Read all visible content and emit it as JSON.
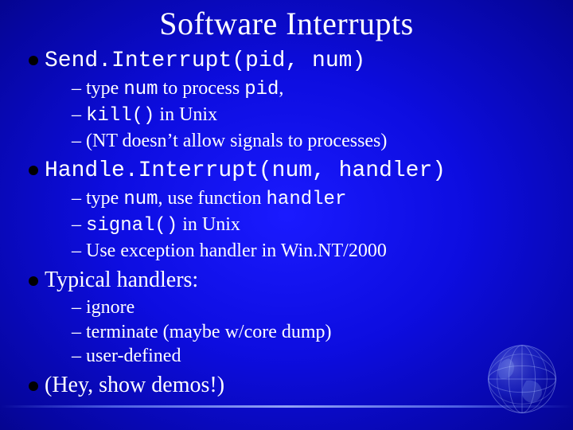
{
  "title": "Software Interrupts",
  "bullets": [
    {
      "main": {
        "segments": [
          {
            "text": "Send.Interrupt(pid, num)",
            "mono": true
          }
        ]
      },
      "subs": [
        {
          "segments": [
            {
              "text": "type "
            },
            {
              "text": "num",
              "mono": true
            },
            {
              "text": " to process "
            },
            {
              "text": "pid",
              "mono": true
            },
            {
              "text": ","
            }
          ]
        },
        {
          "segments": [
            {
              "text": "kill()",
              "mono": true
            },
            {
              "text": " in Unix"
            }
          ]
        },
        {
          "segments": [
            {
              "text": "(NT doesn’t allow signals to processes)"
            }
          ]
        }
      ]
    },
    {
      "main": {
        "segments": [
          {
            "text": "Handle.Interrupt(num, handler)",
            "mono": true
          }
        ]
      },
      "subs": [
        {
          "segments": [
            {
              "text": "type "
            },
            {
              "text": "num",
              "mono": true
            },
            {
              "text": ", use function "
            },
            {
              "text": "handler",
              "mono": true
            }
          ]
        },
        {
          "segments": [
            {
              "text": "signal()",
              "mono": true
            },
            {
              "text": " in Unix"
            }
          ]
        },
        {
          "segments": [
            {
              "text": "Use exception handler in Win.NT/2000"
            }
          ]
        }
      ]
    },
    {
      "main": {
        "segments": [
          {
            "text": "Typical handlers:"
          }
        ]
      },
      "subs": [
        {
          "segments": [
            {
              "text": "ignore"
            }
          ]
        },
        {
          "segments": [
            {
              "text": "terminate (maybe w/core dump)"
            }
          ]
        },
        {
          "segments": [
            {
              "text": "user-defined"
            }
          ]
        }
      ]
    },
    {
      "main": {
        "segments": [
          {
            "text": "(Hey, show demos!)"
          }
        ]
      },
      "subs": []
    }
  ],
  "dash": "–  "
}
